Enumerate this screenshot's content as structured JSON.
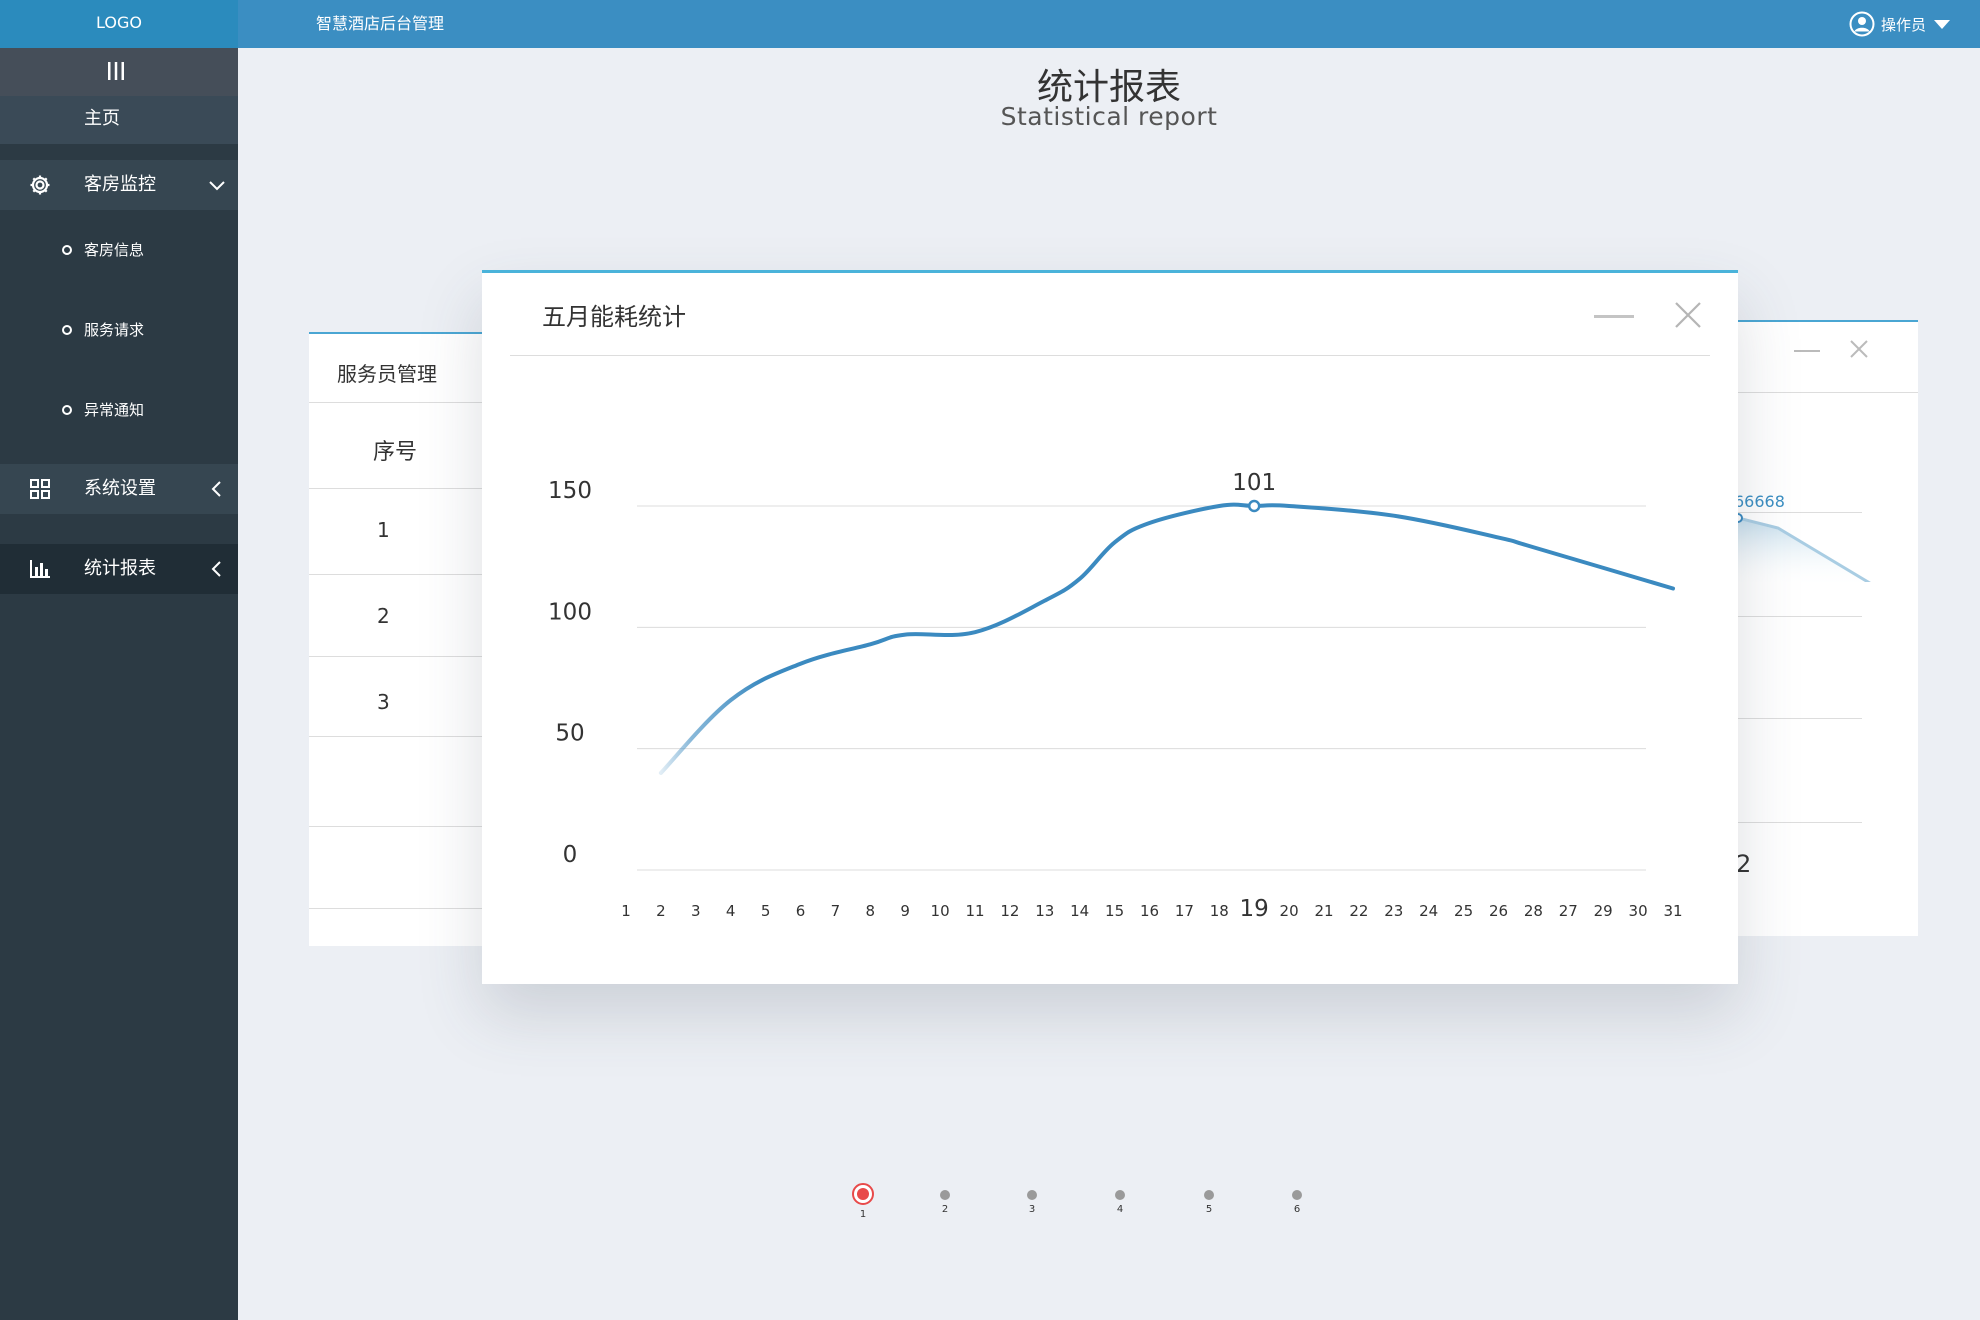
{
  "header": {
    "logo": "LOGO",
    "system_title": "智慧酒店后台管理",
    "user_label": "操作员"
  },
  "sidebar": {
    "home_label": "主页",
    "groups": [
      {
        "label": "客房监控",
        "icon": "gear-icon",
        "expanded": true,
        "items": [
          "客房信息",
          "服务请求",
          "异常通知"
        ]
      },
      {
        "label": "系统设置",
        "icon": "grid-icon",
        "expanded": false
      },
      {
        "label": "统计报表",
        "icon": "bar-chart-icon",
        "expanded": false,
        "active": true
      }
    ]
  },
  "page": {
    "title": "统计报表",
    "subtitle": "Statistical report"
  },
  "back_left_card": {
    "title": "服务员管理",
    "column_header": "序号",
    "rows": [
      "1",
      "2",
      "3"
    ]
  },
  "back_right_card": {
    "peek_value": "66668",
    "peek_value2": "2"
  },
  "modal": {
    "title": "五月能耗统计"
  },
  "chart_data": {
    "type": "line",
    "title": "五月能耗统计",
    "xlabel": "",
    "ylabel": "",
    "ylim": [
      0,
      150
    ],
    "y_ticks": [
      0,
      50,
      100,
      150
    ],
    "x": [
      "1",
      "2",
      "3",
      "4",
      "5",
      "6",
      "7",
      "8",
      "9",
      "10",
      "11",
      "12",
      "13",
      "14",
      "15",
      "16",
      "17",
      "18",
      "19",
      "20",
      "21",
      "22",
      "23",
      "24",
      "25",
      "26",
      "28",
      "27",
      "29",
      "30",
      "31"
    ],
    "highlight": {
      "x": "19",
      "label": "101",
      "value": 150
    },
    "series": [
      {
        "color": "#3b8ac0",
        "points": [
          {
            "x": "2",
            "y": 40
          },
          {
            "x": "4",
            "y": 70
          },
          {
            "x": "6",
            "y": 85
          },
          {
            "x": "8",
            "y": 93
          },
          {
            "x": "9",
            "y": 97
          },
          {
            "x": "11",
            "y": 98
          },
          {
            "x": "13",
            "y": 111
          },
          {
            "x": "14",
            "y": 120
          },
          {
            "x": "15",
            "y": 135
          },
          {
            "x": "16",
            "y": 143
          },
          {
            "x": "18",
            "y": 150
          },
          {
            "x": "19",
            "y": 150
          },
          {
            "x": "20",
            "y": 150
          },
          {
            "x": "23",
            "y": 146
          },
          {
            "x": "26",
            "y": 137
          },
          {
            "x": "28",
            "y": 133
          },
          {
            "x": "31",
            "y": 116
          }
        ]
      }
    ],
    "grid": true,
    "legend": "none"
  },
  "pager": {
    "pages": [
      "1",
      "2",
      "3",
      "4",
      "5",
      "6"
    ],
    "active": "1",
    "active_color": "#e84a4a"
  }
}
